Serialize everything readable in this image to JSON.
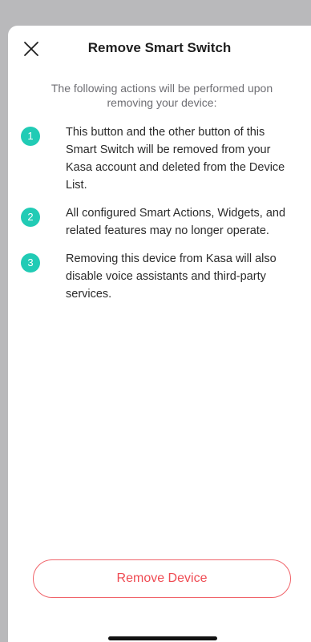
{
  "header": {
    "title": "Remove Smart Switch",
    "close_icon": "close-icon"
  },
  "intro": "The following actions will be performed upon removing your device:",
  "steps": [
    {
      "number": "1",
      "text": "This button and the other button of this Smart Switch will be removed from your Kasa account and deleted from the Device List."
    },
    {
      "number": "2",
      "text": "All configured Smart Actions, Widgets, and related features may no longer operate."
    },
    {
      "number": "3",
      "text": "Removing this device from Kasa will also disable voice assistants and third-party services."
    }
  ],
  "actions": {
    "remove_label": "Remove Device"
  },
  "colors": {
    "accent_teal": "#21cbb5",
    "danger_red": "#ef4b53",
    "backdrop": "#b9b9bb"
  }
}
